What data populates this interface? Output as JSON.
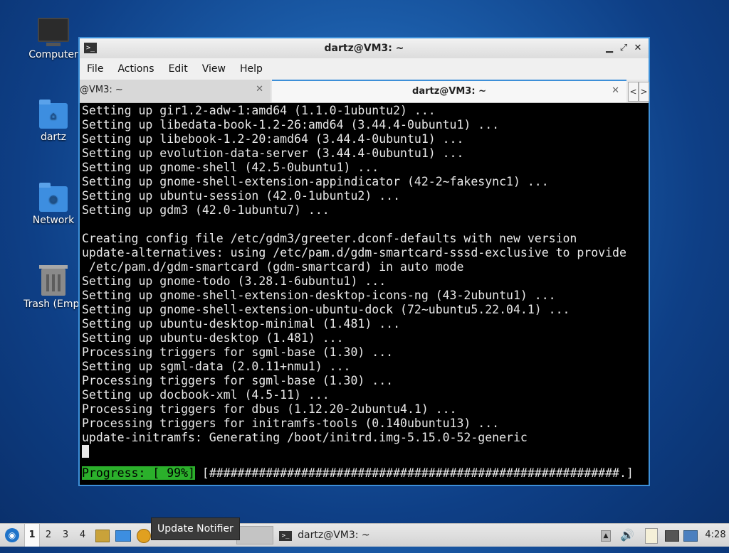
{
  "desktop": {
    "icons": [
      {
        "label": "Computer",
        "icon": "computer-icon"
      },
      {
        "label": "dartz",
        "icon": "home-folder-icon"
      },
      {
        "label": "Network",
        "icon": "network-folder-icon"
      },
      {
        "label": "Trash (Empt",
        "icon": "trash-icon"
      }
    ]
  },
  "window": {
    "title": "dartz@VM3: ~",
    "controls": {
      "minimize": "▁",
      "maximize": "⤢",
      "close": "✕"
    },
    "menu": [
      "File",
      "Actions",
      "Edit",
      "View",
      "Help"
    ],
    "tabs": [
      {
        "label": "@VM3: ~",
        "active": false,
        "close": "✕"
      },
      {
        "label": "dartz@VM3: ~",
        "active": true,
        "close": "✕"
      }
    ],
    "tab_scroll": {
      "left": "<",
      "right": ">"
    }
  },
  "terminal": {
    "lines": [
      "Setting up gir1.2-adw-1:amd64 (1.1.0-1ubuntu2) ...",
      "Setting up libedata-book-1.2-26:amd64 (3.44.4-0ubuntu1) ...",
      "Setting up libebook-1.2-20:amd64 (3.44.4-0ubuntu1) ...",
      "Setting up evolution-data-server (3.44.4-0ubuntu1) ...",
      "Setting up gnome-shell (42.5-0ubuntu1) ...",
      "Setting up gnome-shell-extension-appindicator (42-2~fakesync1) ...",
      "Setting up ubuntu-session (42.0-1ubuntu2) ...",
      "Setting up gdm3 (42.0-1ubuntu7) ...",
      "",
      "Creating config file /etc/gdm3/greeter.dconf-defaults with new version",
      "update-alternatives: using /etc/pam.d/gdm-smartcard-sssd-exclusive to provide",
      " /etc/pam.d/gdm-smartcard (gdm-smartcard) in auto mode",
      "Setting up gnome-todo (3.28.1-6ubuntu1) ...",
      "Setting up gnome-shell-extension-desktop-icons-ng (43-2ubuntu1) ...",
      "Setting up gnome-shell-extension-ubuntu-dock (72~ubuntu5.22.04.1) ...",
      "Setting up ubuntu-desktop-minimal (1.481) ...",
      "Setting up ubuntu-desktop (1.481) ...",
      "Processing triggers for sgml-base (1.30) ...",
      "Setting up sgml-data (2.0.11+nmu1) ...",
      "Processing triggers for sgml-base (1.30) ...",
      "Setting up docbook-xml (4.5-11) ...",
      "Processing triggers for dbus (1.12.20-2ubuntu4.1) ...",
      "Processing triggers for initramfs-tools (0.140ubuntu13) ...",
      "update-initramfs: Generating /boot/initrd.img-5.15.0-52-generic"
    ],
    "progress_label": "Progress: [ 99%]",
    "progress_bar": " [##########################################################.]",
    "progress_percent": 99
  },
  "taskbar": {
    "workspaces": [
      "1",
      "2",
      "3",
      "4"
    ],
    "active_workspace": "1",
    "tooltip": "Update Notifier",
    "task_label": "dartz@VM3: ~",
    "clock": "4:28"
  },
  "colors": {
    "progress_green": "#2bb02b",
    "window_border": "#3d8fd8"
  }
}
